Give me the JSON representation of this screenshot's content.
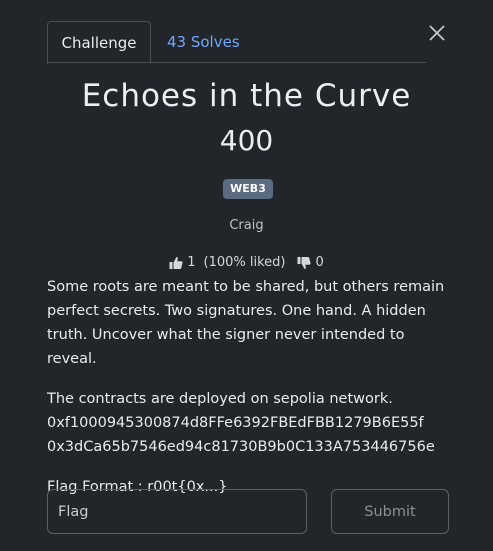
{
  "tabs": {
    "challenge_label": "Challenge",
    "solves_label": "43 Solves"
  },
  "challenge": {
    "title": "Echoes in the Curve",
    "points": "400",
    "category": "WEB3",
    "author": "Craig",
    "likes": "1",
    "liked_percent": "(100% liked)",
    "dislikes": "0",
    "description": {
      "paragraph1": "Some roots are meant to be shared, but others remain perfect secrets. Two signatures. One hand. A hidden truth. Uncover what the signer never intended to reveal.",
      "paragraph2_intro": "The contracts are deployed on sepolia network.",
      "address1": "0xf1000945300874d8FFe6392FBEdFBB1279B6E55f",
      "address2": "0x3dCa65b7546ed94c81730B9b0C133A753446756e",
      "flag_format": "Flag Format : r00t{0x...}"
    }
  },
  "form": {
    "flag_placeholder": "Flag",
    "submit_label": "Submit"
  },
  "icons": {
    "close": "close-icon",
    "like": "thumbs-up-icon",
    "dislike": "thumbs-down-icon"
  },
  "colors": {
    "background": "#222529",
    "link": "#6ea8fe",
    "badge": "#5b6b80"
  }
}
